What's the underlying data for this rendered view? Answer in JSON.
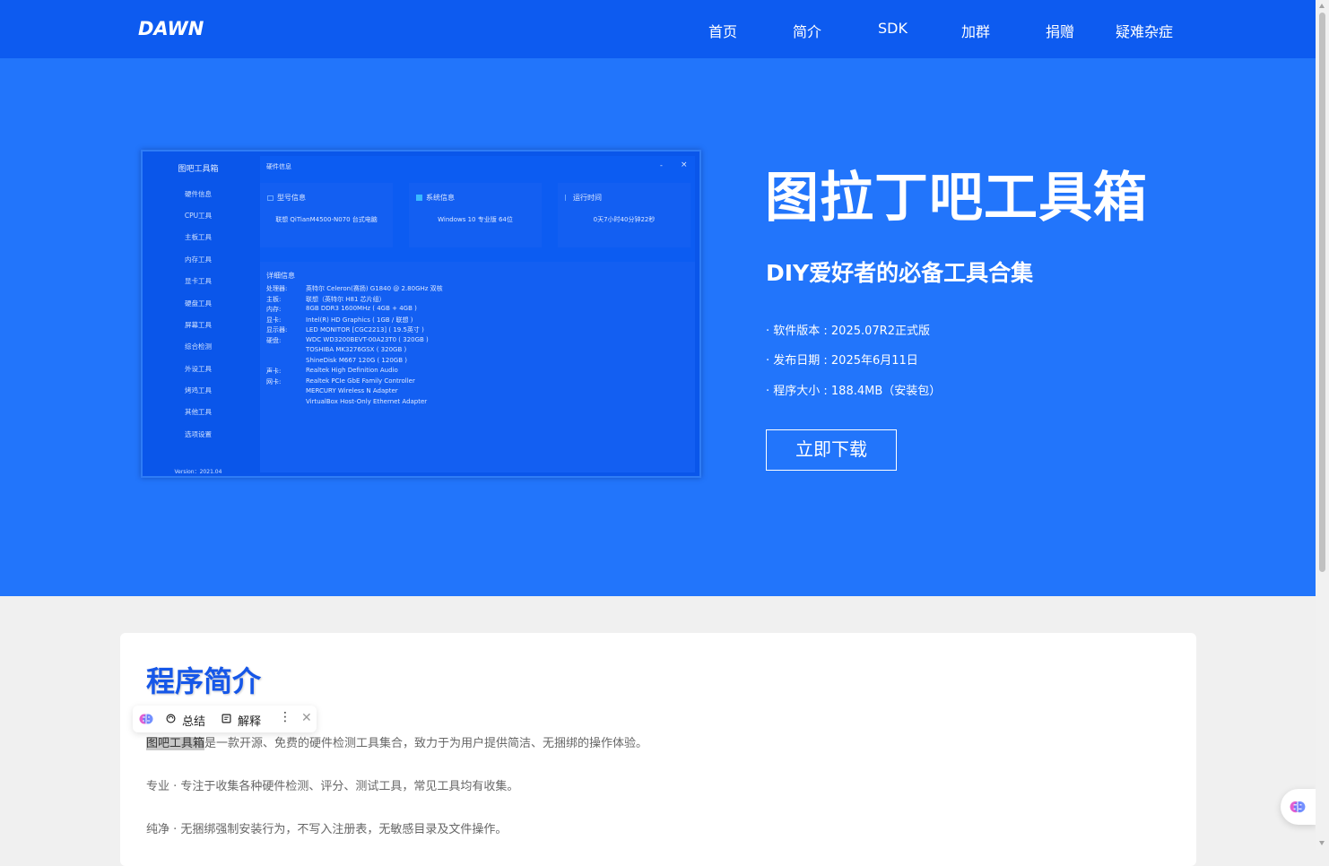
{
  "header": {
    "logo": "DAWN",
    "nav": [
      "首页",
      "简介",
      "SDK",
      "加群",
      "捐赠",
      "疑难杂症"
    ]
  },
  "app_preview": {
    "title": "图吧工具箱",
    "sidebar": [
      "硬件信息",
      "CPU工具",
      "主板工具",
      "内存工具",
      "显卡工具",
      "硬盘工具",
      "屏幕工具",
      "综合检测",
      "外设工具",
      "烤鸡工具",
      "其他工具",
      "选项设置"
    ],
    "version": "Version：2021.04",
    "window_title": "硬件信息",
    "window_min": "-",
    "window_close": "×",
    "cards": [
      {
        "title": "型号信息",
        "value": "联想 QiTianM4500-N070 台式电脑"
      },
      {
        "title": "系统信息",
        "value": "Windows 10 专业版 64位"
      },
      {
        "title": "运行时间",
        "value": "0天7小时40分钟22秒"
      }
    ],
    "detail_title": "详细信息",
    "details": [
      {
        "label": "处理器:",
        "value": "英特尔 Celeron(赛扬) G1840 @ 2.80GHz 双核"
      },
      {
        "label": "主板:",
        "value": "联想（英特尔 H81 芯片组）"
      },
      {
        "label": "内存:",
        "value": "8GB DDR3 1600MHz ( 4GB + 4GB )"
      },
      {
        "label": "显卡:",
        "value": "Intel(R) HD Graphics ( 1GB / 联想 )"
      },
      {
        "label": "显示器:",
        "value": "LED MONITOR [CGC2213] ( 19.5英寸 )"
      },
      {
        "label": "硬盘:",
        "value": "WDC WD3200BEVT-00A23T0 ( 320GB )"
      },
      {
        "label": "",
        "value": "TOSHIBA MK3276GSX ( 320GB )"
      },
      {
        "label": "",
        "value": "ShineDisk M667 120G ( 120GB )"
      },
      {
        "label": "声卡:",
        "value": "Realtek High Definition Audio"
      },
      {
        "label": "网卡:",
        "value": "Realtek PCIe GbE Family Controller"
      },
      {
        "label": "",
        "value": "MERCURY Wireless N Adapter"
      },
      {
        "label": "",
        "value": "VirtualBox Host-Only Ethernet Adapter"
      }
    ]
  },
  "hero": {
    "title": "图拉丁吧工具箱",
    "subtitle": "DIY爱好者的必备工具合集",
    "info": [
      "· 软件版本 : 2025.07R2正式版",
      "· 发布日期 : 2025年6月11日",
      "· 程序大小 : 188.4MB（安装包）"
    ],
    "download_label": "立即下载"
  },
  "intro": {
    "title": "程序简介",
    "highlight": "图吧工具箱",
    "line1_rest": "是一款开源、免费的硬件检测工具集合，致力于为用户提供简洁、无捆绑的操作体验。",
    "line2": "专业 · 专注于收集各种硬件检测、评分、测试工具，常见工具均有收集。",
    "line3": "纯净 · 无捆绑强制安装行为，不写入注册表，无敏感目录及文件操作。"
  },
  "popup": {
    "summarize": "总结",
    "explain": "解释",
    "more": "⋮",
    "close": "✕"
  },
  "colors": {
    "nav_bg": "#0d5bf0",
    "hero_bg": "#2275fb",
    "accent_title": "#1657e8"
  }
}
